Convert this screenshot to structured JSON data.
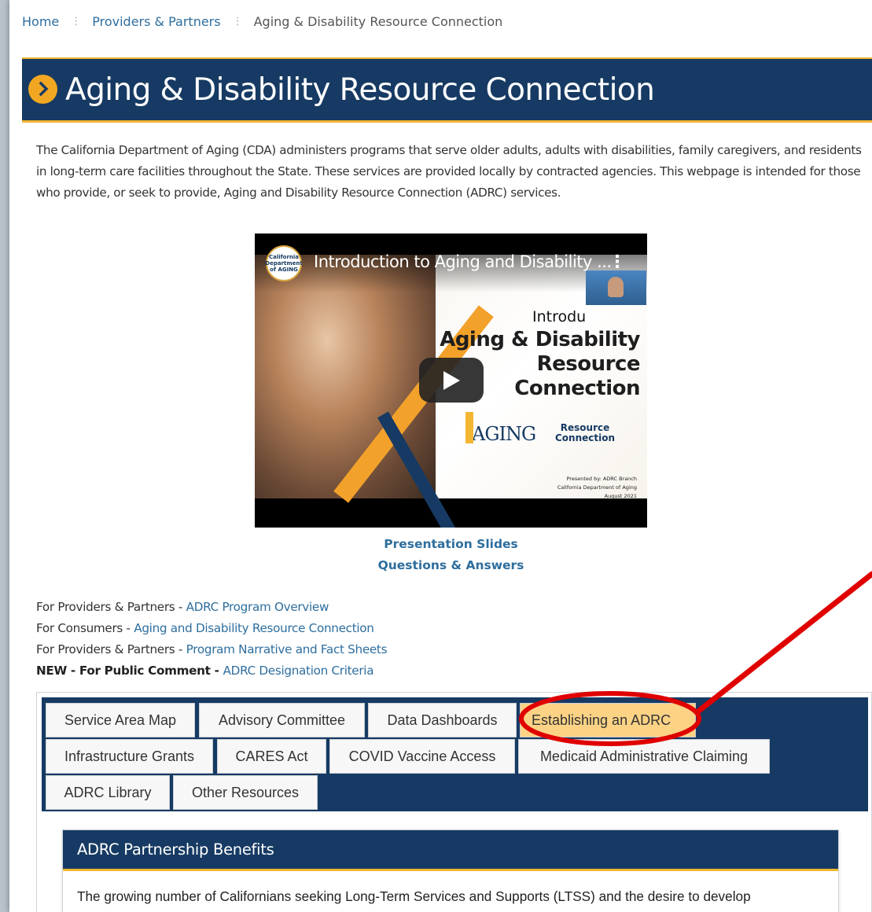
{
  "breadcrumb": {
    "home": "Home",
    "providers": "Providers & Partners",
    "current": "Aging & Disability Resource Connection"
  },
  "page_title": "Aging & Disability Resource Connection",
  "intro": "The California Department of Aging (CDA) administers programs that serve older adults, adults with disabilities, family caregivers, and residents in long-term care facilities throughout the State. These services are provided locally by contracted agencies. This webpage is intended for those who provide, or seek to provide, Aging and Disability Resource Connection (ADRC) services.",
  "video": {
    "title": "Introduction to Aging and Disability ...",
    "channel_logo": "California Department of AGING",
    "slide_intro": "Introdu",
    "slide_title_1": "Aging & Disability",
    "slide_title_2": "Resource Connection",
    "logo_aging": "AGING",
    "logo_rc_1": "Resource",
    "logo_rc_2": "Connection",
    "presented_1": "Presented by: ADRC Branch",
    "presented_2": "California Department of Aging",
    "presented_3": "August 2021"
  },
  "video_links": {
    "slides": "Presentation Slides",
    "qa": "Questions & Answers"
  },
  "links": [
    {
      "prefix": "For Providers & Partners - ",
      "link": "ADRC Program Overview"
    },
    {
      "prefix": "For Consumers - ",
      "link": "Aging and Disability Resource Connection"
    },
    {
      "prefix": "For Providers & Partners - ",
      "link": "Program Narrative and Fact Sheets"
    },
    {
      "prefix": "NEW - For Public Comment - ",
      "link": "ADRC Designation Criteria"
    }
  ],
  "tabs": [
    "Service Area Map",
    "Advisory Committee",
    "Data Dashboards",
    "Establishing an ADRC",
    "Infrastructure Grants",
    "CARES Act",
    "COVID Vaccine Access",
    "Medicaid Administrative Claiming",
    "ADRC Library",
    "Other Resources"
  ],
  "active_tab": "Establishing an ADRC",
  "card": {
    "title": "ADRC Partnership Benefits",
    "body": "The growing number of Californians seeking Long-Term Services and Supports (LTSS) and the desire to develop"
  },
  "colors": {
    "navy": "#163a63",
    "gold": "#f2b632",
    "link": "#2e6e9e",
    "active_tab": "#fcd385",
    "annotation": "#e00000"
  }
}
